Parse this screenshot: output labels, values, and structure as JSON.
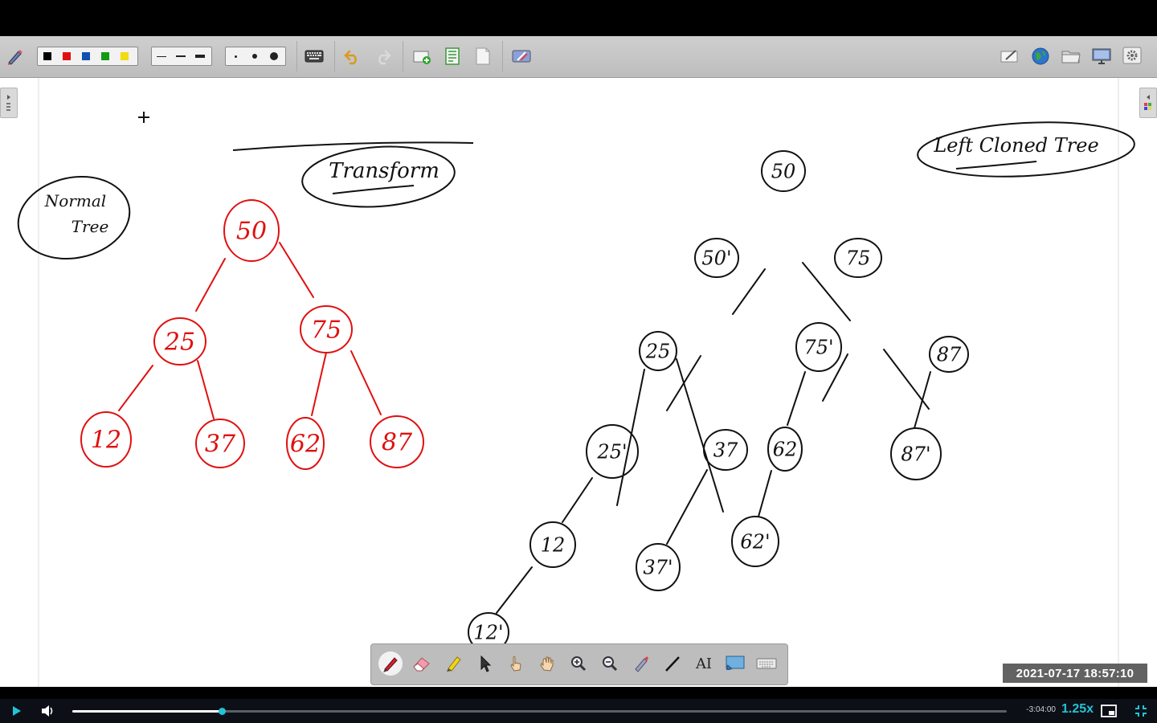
{
  "app": {
    "name": "Whiteboard lecture recording"
  },
  "toolbar": {
    "pen_colors": [
      "#000000",
      "#e01010",
      "#1050b0",
      "#139a13",
      "#f0dc10"
    ],
    "line_widths": [
      "thin",
      "medium",
      "thick"
    ],
    "point_sizes": [
      "small",
      "medium",
      "large"
    ],
    "left_icons": [
      "pen-settings-icon",
      "keyboard-icon",
      "undo-icon",
      "redo-icon",
      "new-page-icon",
      "page-list-icon",
      "blank-page-icon",
      "clear-screen-icon"
    ],
    "right_icons": [
      "edit-page-icon",
      "globe-icon",
      "folder-icon",
      "screen-icon",
      "settings-icon"
    ]
  },
  "board": {
    "ink_colors": {
      "red": "#e01010",
      "black": "#111111"
    },
    "labels": {
      "normal_tree": "Normal Tree",
      "transform": "Transform",
      "left_cloned_tree": "Left Cloned Tree"
    },
    "normal_tree": [
      {
        "id": "n50",
        "value": "50"
      },
      {
        "id": "n25",
        "value": "25"
      },
      {
        "id": "n75",
        "value": "75"
      },
      {
        "id": "n12",
        "value": "12"
      },
      {
        "id": "n37",
        "value": "37"
      },
      {
        "id": "n62",
        "value": "62"
      },
      {
        "id": "n87",
        "value": "87"
      }
    ],
    "cloned_tree": [
      {
        "id": "c50",
        "value": "50"
      },
      {
        "id": "c50p",
        "value": "50'"
      },
      {
        "id": "c75",
        "value": "75"
      },
      {
        "id": "c25",
        "value": "25"
      },
      {
        "id": "c75p",
        "value": "75'"
      },
      {
        "id": "c87",
        "value": "87"
      },
      {
        "id": "c25p",
        "value": "25'"
      },
      {
        "id": "c37",
        "value": "37"
      },
      {
        "id": "c62",
        "value": "62"
      },
      {
        "id": "c87p",
        "value": "87'"
      },
      {
        "id": "c12",
        "value": "12"
      },
      {
        "id": "c37p",
        "value": "37'"
      },
      {
        "id": "c62p",
        "value": "62'"
      },
      {
        "id": "c12p",
        "value": "12'"
      }
    ]
  },
  "bottom_toolbar": {
    "tools": [
      "pen-icon",
      "eraser-icon",
      "highlighter-icon",
      "select-arrow-icon",
      "pointer-hand-icon",
      "pan-hand-icon",
      "zoom-in-icon",
      "zoom-out-icon",
      "laser-pointer-icon",
      "line-tool-icon",
      "text-tool-icon",
      "screen-capture-icon",
      "keyboard-icon"
    ],
    "active_tool": "pen-icon",
    "text_tool_label": "AI"
  },
  "timestamp": "2021-07-17  18:57:10",
  "player": {
    "progress": 0.16,
    "time_remaining": "-3:04:00",
    "speed": "1.25x",
    "accent": "#22c3d6"
  }
}
